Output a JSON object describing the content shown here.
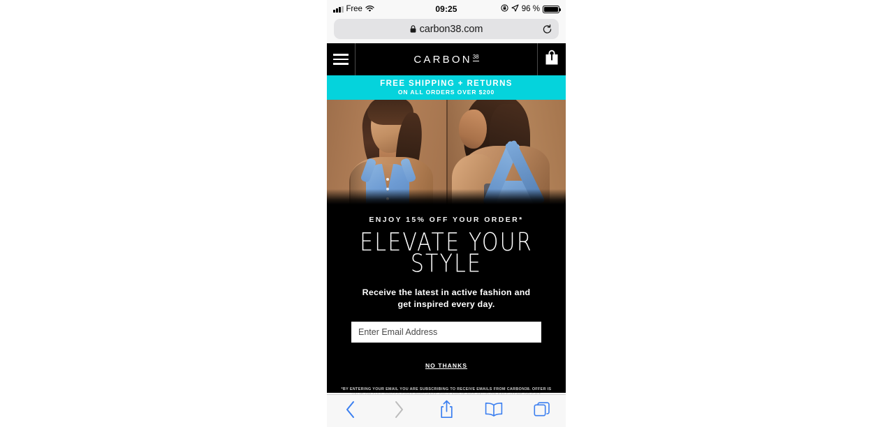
{
  "statusbar": {
    "carrier": "Free",
    "time": "09:25",
    "battery_pct": "96 %",
    "signal_icon": "signal-bars-icon",
    "wifi_icon": "wifi-icon",
    "lock_rotation_icon": "orientation-lock-icon",
    "location_icon": "location-arrow-icon",
    "battery_icon": "battery-icon"
  },
  "browser": {
    "url": "carbon38.com",
    "lock_icon": "lock-icon",
    "reload_icon": "reload-icon",
    "toolbar": {
      "back_icon": "chevron-left-icon",
      "forward_icon": "chevron-right-icon",
      "share_icon": "share-icon",
      "bookmarks_icon": "book-icon",
      "tabs_icon": "tabs-icon"
    }
  },
  "site_header": {
    "menu_icon": "hamburger-menu-icon",
    "logo_text": "CARBON",
    "logo_sup": "38",
    "bag_icon": "shopping-bag-icon"
  },
  "promo_banner": {
    "line1": "FREE SHIPPING + RETURNS",
    "line2": "ON ALL ORDERS OVER $200",
    "background_color": "#05d3dc",
    "text_color": "#ffffff"
  },
  "hero": {
    "alt": "two-panel photo of model wearing blue denim sports bra",
    "background_color": "#a97a52",
    "garment_color": "#6d9bd3"
  },
  "modal": {
    "eyebrow": "ENJOY 15% OFF YOUR ORDER*",
    "headline_line1": "ELEVATE YOUR",
    "headline_line2": "STYLE",
    "subtext": "Receive the latest in active fashion and get inspired every day.",
    "email_placeholder": "Enter Email Address",
    "email_value": "",
    "decline_label": "NO THANKS",
    "fineprint": "*BY ENTERING YOUR EMAIL YOU ARE SUBSCRIBING TO RECEIVE EMAILS FROM CARBON38. OFFER IS VALID ON FULL PRICED FIRST PURCHASE ONLY AND IS NOT VALID ON SALE ITEMS OR GIFT CARDS.OFFER IS NOT TRANSFERABLE, NOT RETROACTIVE, AND NON-REFUNDABLE.",
    "background_color": "#000000",
    "text_color": "#ffffff"
  }
}
